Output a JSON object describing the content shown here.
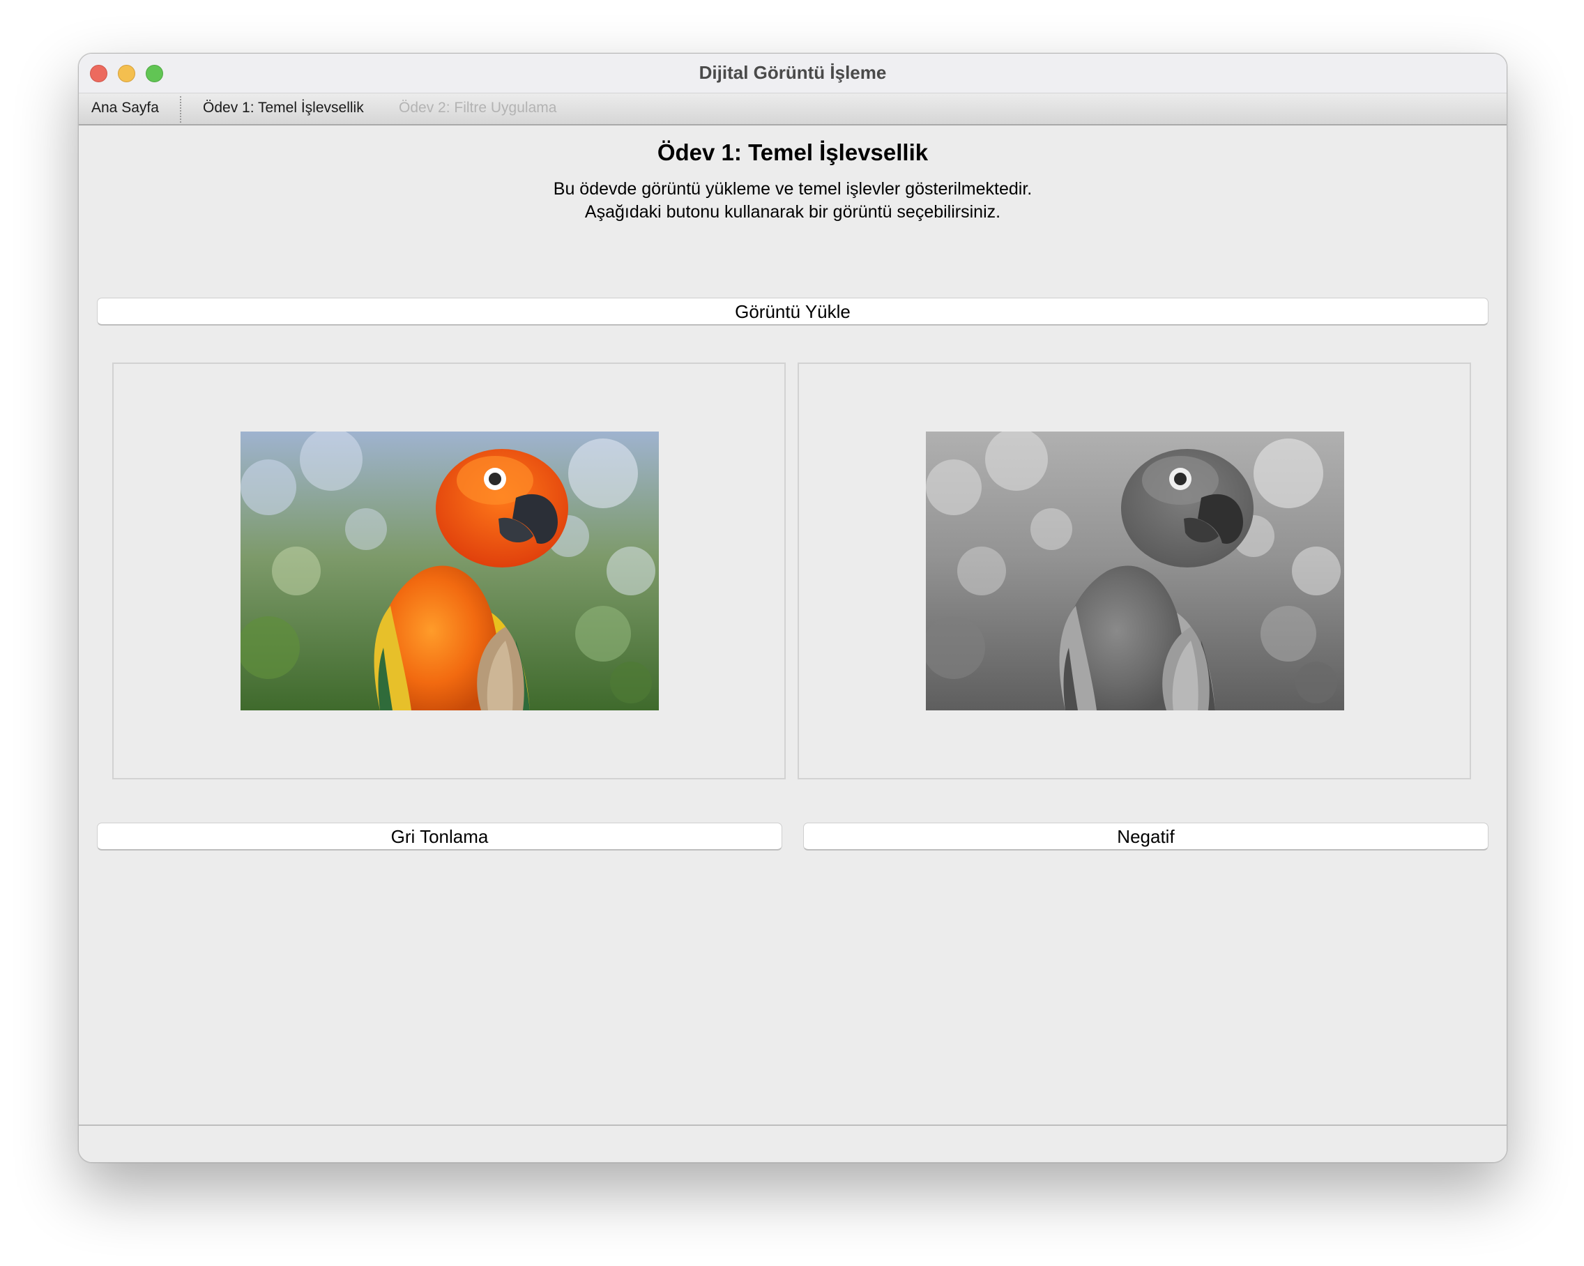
{
  "window": {
    "title": "Dijital Görüntü İşleme"
  },
  "tabs": [
    {
      "label": "Ana Sayfa",
      "state": "normal"
    },
    {
      "label": "Ödev 1: Temel İşlevsellik",
      "state": "selected"
    },
    {
      "label": "Ödev 2: Filtre Uygulama",
      "state": "disabled"
    }
  ],
  "main": {
    "title": "Ödev 1: Temel İşlevsellik",
    "description_line1": "Bu ödevde görüntü yükleme ve temel işlevler gösterilmektedir.",
    "description_line2": "Aşağıdaki butonu kullanarak bir görüntü seçebilirsiniz.",
    "load_button": "Görüntü Yükle",
    "grayscale_button": "Gri Tonlama",
    "negative_button": "Negatif"
  },
  "images": {
    "original": {
      "subject": "parrot",
      "mode": "color"
    },
    "processed": {
      "subject": "parrot",
      "mode": "grayscale"
    }
  },
  "colors": {
    "close": "#ec6a5e",
    "minimize": "#f4bf4f",
    "maximize": "#61c554",
    "window_bg": "#ececec"
  }
}
